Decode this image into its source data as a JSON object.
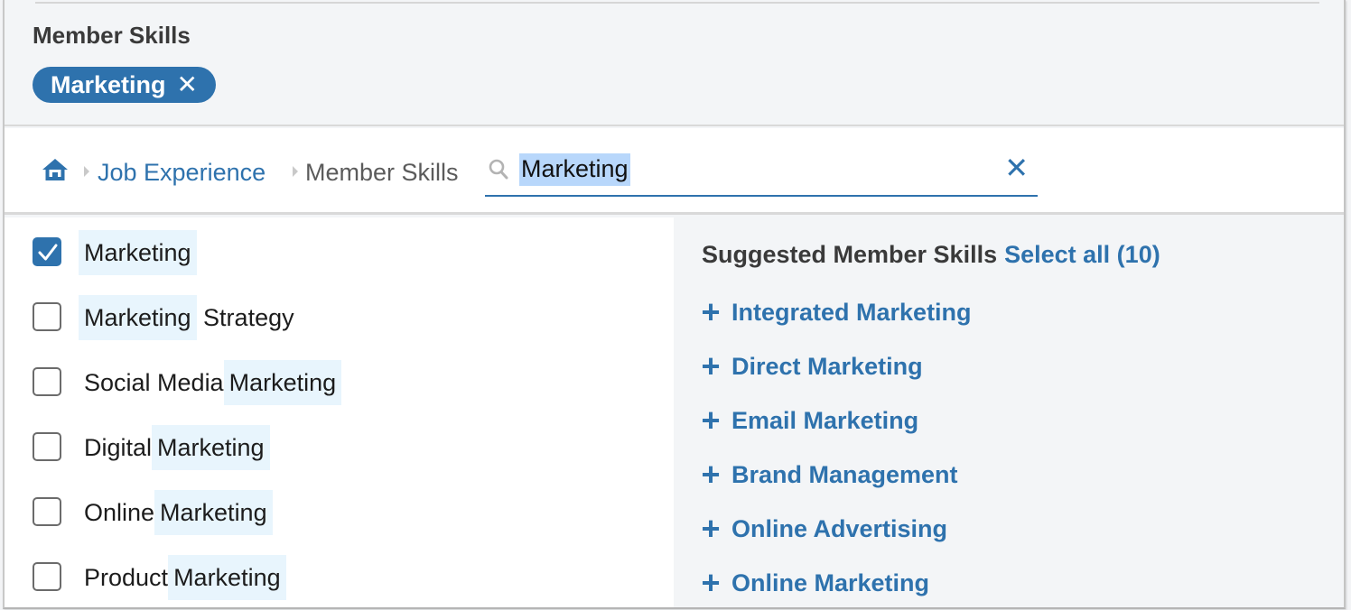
{
  "header": {
    "title": "Member Skills",
    "selected_pill": {
      "label": "Marketing",
      "remove_icon": "close-icon"
    }
  },
  "breadcrumb": {
    "home_icon": "home-icon",
    "items": [
      {
        "label": "Job Experience",
        "link": true
      },
      {
        "label": "Member Skills",
        "link": false
      }
    ]
  },
  "search": {
    "icon": "search-icon",
    "value": "Marketing",
    "clear_icon": "close-icon"
  },
  "results": [
    {
      "prefix": "",
      "match": "Marketing",
      "suffix": "",
      "checked": true
    },
    {
      "prefix": "",
      "match": "Marketing",
      "suffix": " Strategy",
      "checked": false
    },
    {
      "prefix": "Social Media",
      "match": "Marketing",
      "suffix": "",
      "checked": false
    },
    {
      "prefix": "Digital",
      "match": "Marketing",
      "suffix": "",
      "checked": false
    },
    {
      "prefix": "Online",
      "match": "Marketing",
      "suffix": "",
      "checked": false
    },
    {
      "prefix": "Product",
      "match": "Marketing",
      "suffix": "",
      "checked": false
    }
  ],
  "suggestions": {
    "title": "Suggested Member Skills",
    "select_all": "Select all (10)",
    "items": [
      "Integrated Marketing",
      "Direct Marketing",
      "Email Marketing",
      "Brand Management",
      "Online Advertising",
      "Online Marketing"
    ]
  },
  "colors": {
    "accent": "#2e72ad",
    "highlight": "#e8f5fd",
    "selection": "#b8d7fb",
    "panel_bg": "#f3f5f7"
  }
}
